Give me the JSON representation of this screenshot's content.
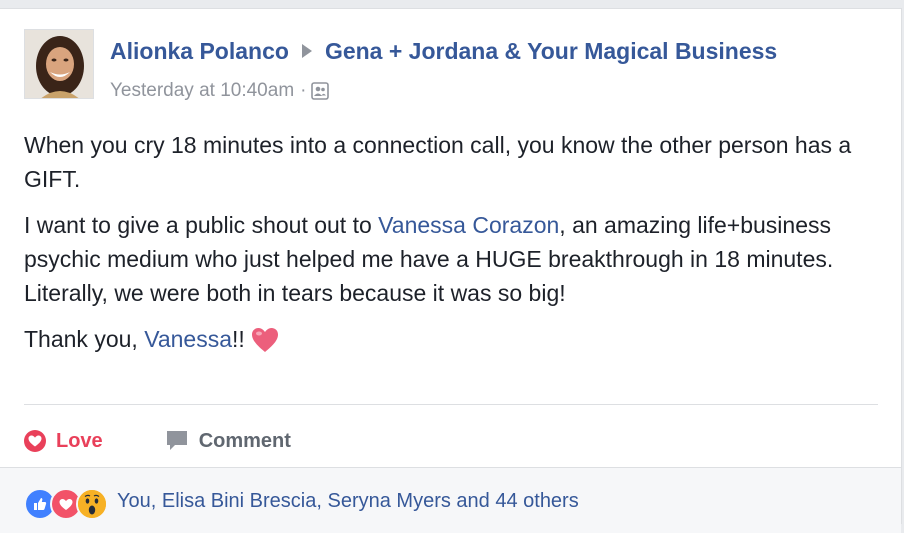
{
  "post": {
    "author": "Alionka Polanco",
    "group": "Gena + Jordana & Your Magical Business",
    "timestamp": "Yesterday at 10:40am",
    "separator": "·",
    "audience_icon": "group-audience-icon",
    "paragraphs": {
      "p1": "When you cry 18 minutes into a connection call, you know the other person has a GIFT.",
      "p2_before": "I want to give a public shout out to ",
      "p2_link": "Vanessa Corazon",
      "p2_after": ", an amazing life+business psychic medium who just helped me have a HUGE breakthrough in 18 minutes. Literally, we were both in tears because it was so big!",
      "p3_before": "Thank you, ",
      "p3_link": "Vanessa",
      "p3_after": "!!"
    }
  },
  "actions": {
    "love_label": "Love",
    "comment_label": "Comment"
  },
  "reactions": {
    "icons": [
      "like-reaction-icon",
      "love-reaction-icon",
      "wow-reaction-icon"
    ],
    "summary": "You, Elisa Bini Brescia, Seryna Myers and 44 others"
  },
  "colors": {
    "link": "#365899",
    "love": "#e9405a",
    "muted": "#90949c",
    "like_blue": "#4080ff",
    "wow_yellow": "#f7b125"
  }
}
